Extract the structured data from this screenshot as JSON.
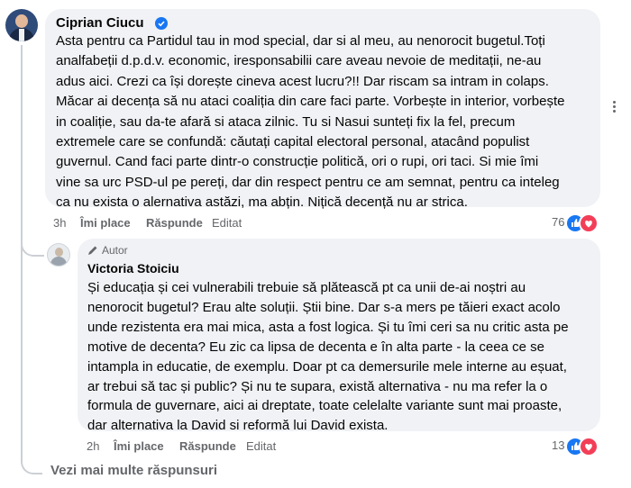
{
  "comment": {
    "author": "Ciprian Ciucu",
    "text_lines": [
      "Asta pentru ca Partidul tau in mod special, dar si al meu, au nenorocit bugetul.Toți",
      "analfabeții d.p.d.v. economic, iresponsabilii care aveau nevoie de meditații, ne-au",
      "adus aici. Crezi ca își dorește cineva acest lucru?!! Dar riscam sa intram in colaps.",
      "Măcar ai decența să nu ataci coaliția din care faci parte. Vorbește in interior, vorbește",
      "in coaliție, sau da-te afară si ataca zilnic. Tu si Nasui sunteți fix la fel, precum",
      "extremele care se confundă: căutați capital electoral personal, atacând populist",
      "guvernul. Cand faci parte dintr-o construcție politică, ori o rupi, ori taci. Si mie îmi",
      "vine sa urc PSD-ul pe pereți, dar din respect pentru ce am semnat, pentru ca inteleg",
      "ca nu exista o alernativa astăzi, ma abțin. Nițică decență nu ar strica."
    ],
    "time": "3h",
    "like": "Îmi place",
    "reply": "Răspunde",
    "edited": "Editat",
    "reaction_count": "76"
  },
  "reply": {
    "badge": "Autor",
    "author": "Victoria Stoiciu",
    "text_lines": [
      "Și educația și cei vulnerabili trebuie să plătească pt ca unii de-ai noștri au",
      "nenorocit bugetul? Erau alte soluții. Știi bine. Dar s-a mers pe tăieri exact acolo",
      "unde rezistenta era mai mica, asta a fost logica. Și tu îmi ceri sa nu critic asta pe",
      "motive de decenta? Eu zic ca lipsa de decenta e în alta parte - la ceea ce se",
      "intampla in educatie, de exemplu. Doar pt ca demersurile mele interne au eșuat,",
      "ar trebui să tac și public? Și nu te supara, există alternativa - nu ma refer la o",
      "formula de guvernare, aici ai dreptate, toate celelalte variante sunt mai proaste,",
      "dar alternativa la David si reformă lui David exista."
    ],
    "time": "2h",
    "like": "Îmi place",
    "reply": "Răspunde",
    "edited": "Editat",
    "reaction_count": "13"
  },
  "more_replies": "Vezi mai multe răspunsuri",
  "colors": {
    "like": "#1877f2",
    "love": "#f33e58",
    "meta": "#65676b",
    "bubble": "#f0f2f5"
  },
  "icons": [
    "verified-badge-icon",
    "pen-icon",
    "like-reaction-icon",
    "love-reaction-icon",
    "more-options-icon"
  ]
}
